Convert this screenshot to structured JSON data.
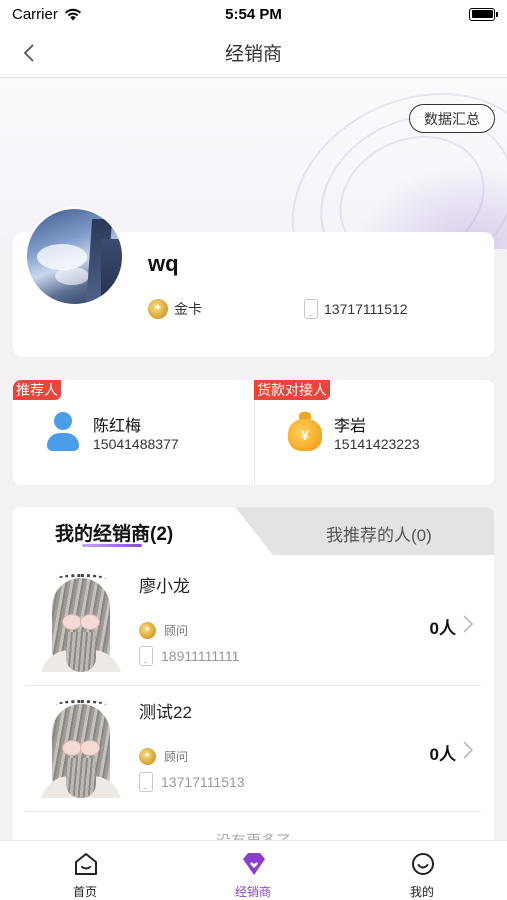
{
  "status_bar": {
    "carrier": "Carrier",
    "time": "5:54 PM"
  },
  "nav": {
    "title": "经销商"
  },
  "header": {
    "data_summary_label": "数据汇总"
  },
  "profile": {
    "name": "wq",
    "level": "金卡",
    "phone": "13717111512"
  },
  "contacts": {
    "referrer": {
      "tag": "推荐人",
      "name": "陈红梅",
      "phone": "15041488377"
    },
    "payment": {
      "tag": "货款对接人",
      "name": "李岩",
      "phone": "15141423223"
    }
  },
  "tabs": {
    "active_label": "我的经销商(2)",
    "inactive_label": "我推荐的人(0)"
  },
  "dealers": [
    {
      "name": "廖小龙",
      "level": "顾问",
      "phone": "18911111111",
      "count": "0人"
    },
    {
      "name": "测试22",
      "level": "顾问",
      "phone": "13717111513",
      "count": "0人"
    }
  ],
  "list_footer": "没有更多了",
  "bottom_tabs": [
    {
      "label": "首页",
      "icon": "home-icon"
    },
    {
      "label": "经销商",
      "icon": "diamond-heart-icon"
    },
    {
      "label": "我的",
      "icon": "smile-icon"
    }
  ],
  "colors": {
    "accent_purple": "#8a3fcf",
    "tag_red": "#e8453c",
    "person_blue": "#4a9de9",
    "gold": "#f3a21f"
  }
}
